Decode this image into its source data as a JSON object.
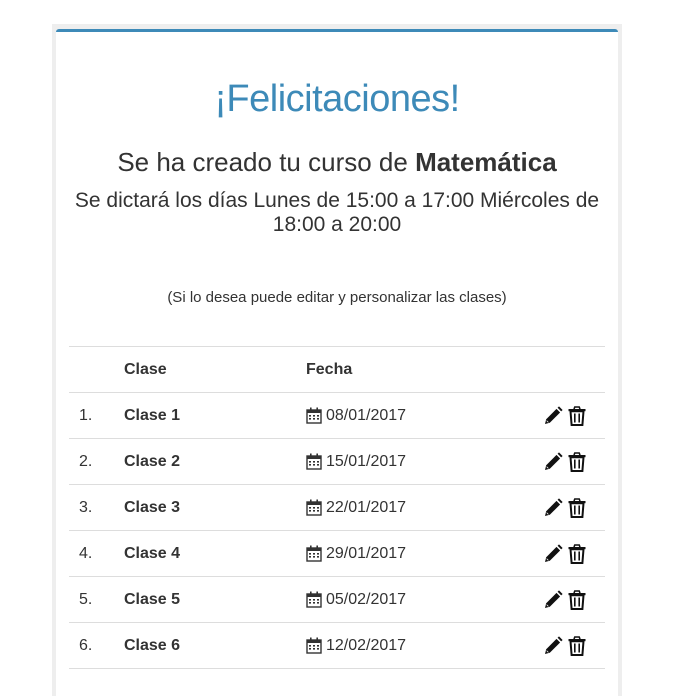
{
  "header": {
    "title": "¡Felicitaciones!",
    "subtitle_prefix": "Se ha creado tu curso de ",
    "course_name": "Matemática",
    "schedule": "Se dictará los días Lunes de 15:00 a 17:00 Miércoles de 18:00 a 20:00",
    "hint": "(Si lo desea puede editar y personalizar las clases)"
  },
  "table": {
    "columns": [
      "",
      "Clase",
      "Fecha",
      ""
    ],
    "rows": [
      {
        "num": "1.",
        "name": "Clase 1",
        "date": "08/01/2017"
      },
      {
        "num": "2.",
        "name": "Clase 2",
        "date": "15/01/2017"
      },
      {
        "num": "3.",
        "name": "Clase 3",
        "date": "22/01/2017"
      },
      {
        "num": "4.",
        "name": "Clase 4",
        "date": "29/01/2017"
      },
      {
        "num": "5.",
        "name": "Clase 5",
        "date": "05/02/2017"
      },
      {
        "num": "6.",
        "name": "Clase 6",
        "date": "12/02/2017"
      }
    ]
  },
  "icons": {
    "date": "calendar-icon",
    "edit": "pencil-icon",
    "delete": "trash-icon"
  },
  "colors": {
    "accent": "#3d8ab8",
    "text": "#333333",
    "divider": "#dddddd"
  }
}
